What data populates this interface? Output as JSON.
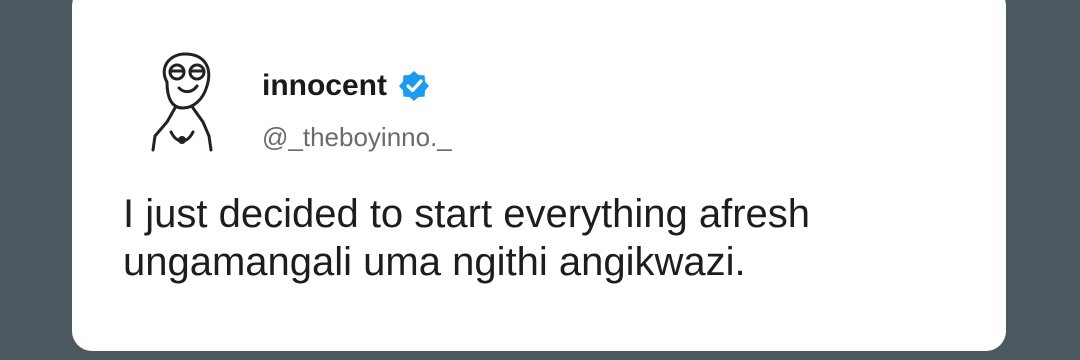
{
  "tweet": {
    "author": {
      "display_name": "innocent",
      "handle": "@_theboyinno._",
      "avatar_icon": "meme-face-avatar",
      "verified_icon": "verified-badge-icon",
      "verified_color": "#1d9bf0"
    },
    "text_lines": [
      "I just decided to start everything afresh",
      "ungamangali uma ngithi angikwazi."
    ]
  },
  "colors": {
    "background": "#4b5860",
    "card": "#ffffff",
    "text": "#1d1d1d",
    "handle": "#6b6b6b"
  }
}
